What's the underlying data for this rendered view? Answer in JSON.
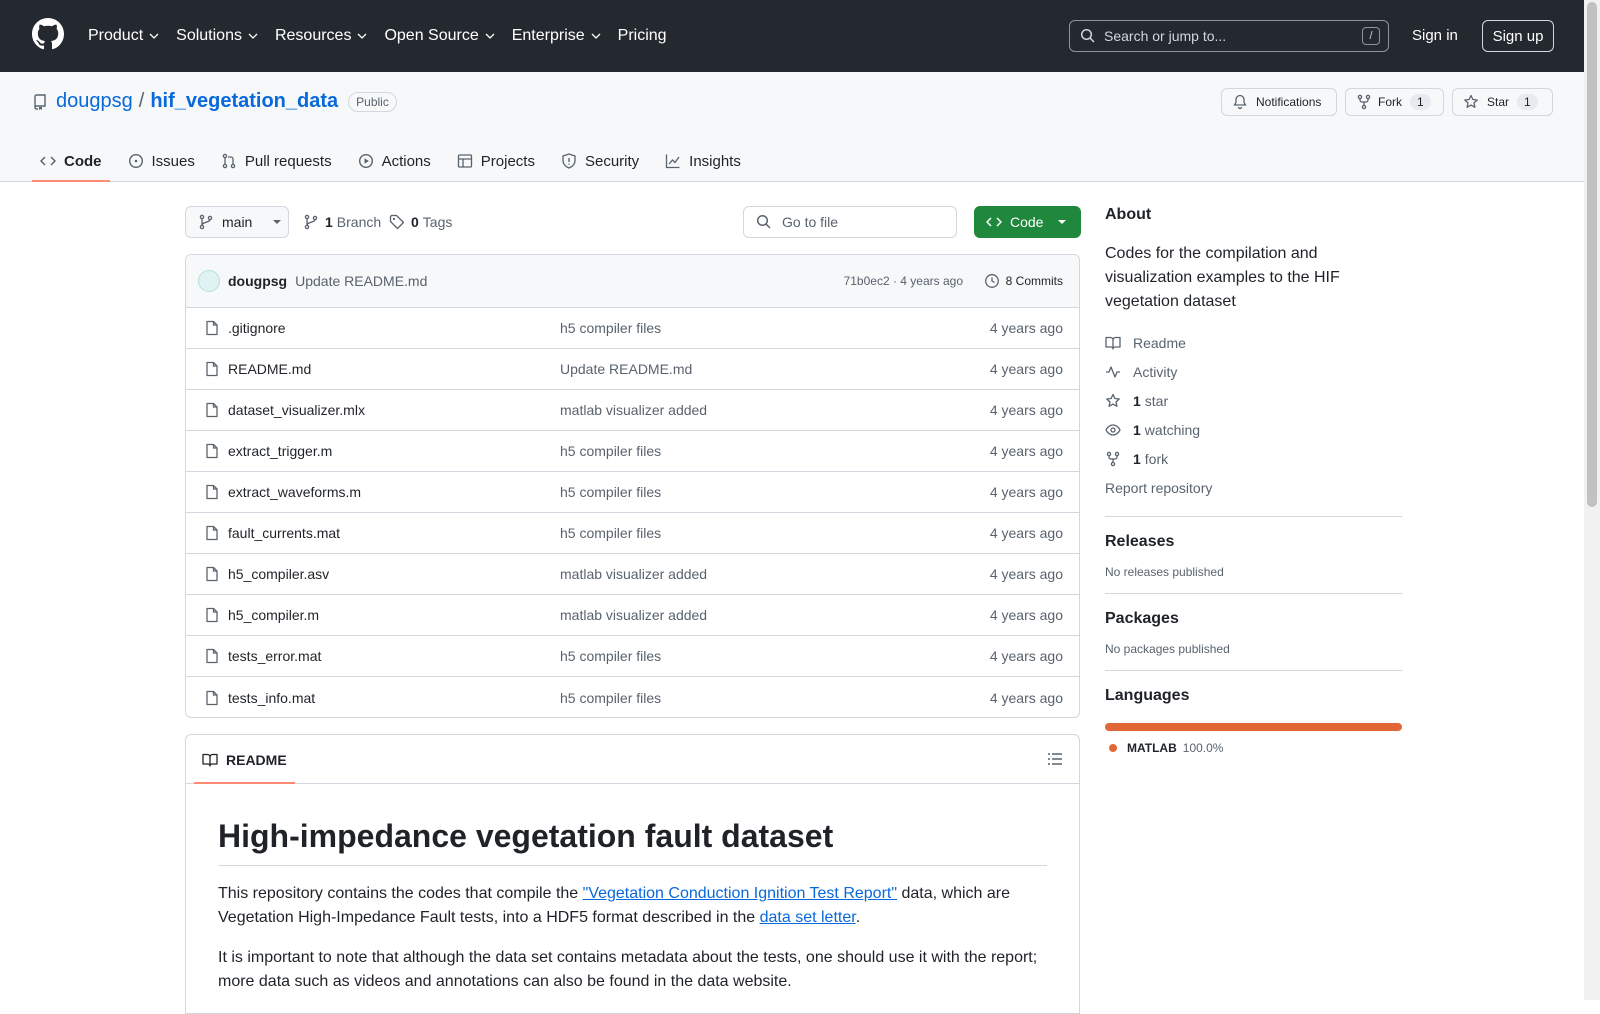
{
  "header": {
    "nav": [
      {
        "label": "Product",
        "dropdown": true
      },
      {
        "label": "Solutions",
        "dropdown": true
      },
      {
        "label": "Resources",
        "dropdown": true
      },
      {
        "label": "Open Source",
        "dropdown": true
      },
      {
        "label": "Enterprise",
        "dropdown": true
      },
      {
        "label": "Pricing",
        "dropdown": false
      }
    ],
    "search_placeholder": "Search or jump to...",
    "search_shortcut": "/",
    "sign_in": "Sign in",
    "sign_up": "Sign up"
  },
  "repo": {
    "owner": "dougpsg",
    "separator": "/",
    "name": "hif_vegetation_data",
    "visibility": "Public",
    "notifications_label": "Notifications",
    "fork_label": "Fork",
    "fork_count": "1",
    "star_label": "Star",
    "star_count": "1",
    "tabs": [
      {
        "label": "Code",
        "icon": "code-icon",
        "active": true
      },
      {
        "label": "Issues",
        "icon": "issue-icon",
        "active": false
      },
      {
        "label": "Pull requests",
        "icon": "pull-request-icon",
        "active": false
      },
      {
        "label": "Actions",
        "icon": "play-icon",
        "active": false
      },
      {
        "label": "Projects",
        "icon": "table-icon",
        "active": false
      },
      {
        "label": "Security",
        "icon": "shield-icon",
        "active": false
      },
      {
        "label": "Insights",
        "icon": "graph-icon",
        "active": false
      }
    ]
  },
  "toolbar": {
    "branch": "main",
    "branch_count": "1",
    "branch_label": "Branch",
    "tag_count": "0",
    "tag_label": "Tags",
    "go_to_file": "Go to file",
    "code_button": "Code"
  },
  "latest_commit": {
    "author": "dougpsg",
    "message": "Update README.md",
    "sha_time": "71b0ec2 · 4 years ago",
    "commits": "8 Commits"
  },
  "files": [
    {
      "name": ".gitignore",
      "message": "h5 compiler files",
      "age": "4 years ago"
    },
    {
      "name": "README.md",
      "message": "Update README.md",
      "age": "4 years ago"
    },
    {
      "name": "dataset_visualizer.mlx",
      "message": "matlab visualizer added",
      "age": "4 years ago"
    },
    {
      "name": "extract_trigger.m",
      "message": "h5 compiler files",
      "age": "4 years ago"
    },
    {
      "name": "extract_waveforms.m",
      "message": "h5 compiler files",
      "age": "4 years ago"
    },
    {
      "name": "fault_currents.mat",
      "message": "h5 compiler files",
      "age": "4 years ago"
    },
    {
      "name": "h5_compiler.asv",
      "message": "matlab visualizer added",
      "age": "4 years ago"
    },
    {
      "name": "h5_compiler.m",
      "message": "matlab visualizer added",
      "age": "4 years ago"
    },
    {
      "name": "tests_error.mat",
      "message": "h5 compiler files",
      "age": "4 years ago"
    },
    {
      "name": "tests_info.mat",
      "message": "h5 compiler files",
      "age": "4 years ago"
    }
  ],
  "readme": {
    "tab_label": "README",
    "title": "High-impedance vegetation fault dataset",
    "p1_before": "This repository contains the codes that compile the ",
    "p1_link1": "\"Vegetation Conduction Ignition Test Report\"",
    "p1_middle": " data, which are Vegetation High-Impedance Fault tests, into a HDF5 format described in the ",
    "p1_link2": "data set letter",
    "p1_after": ".",
    "p2": "It is important to note that although the data set contains metadata about the tests, one should use it with the report; more data such as videos and annotations can also be found in the data website."
  },
  "about": {
    "heading": "About",
    "description": "Codes for the compilation and visualization examples to the HIF vegetation dataset",
    "readme": "Readme",
    "activity": "Activity",
    "stars_count": "1",
    "stars_label": "star",
    "watching_count": "1",
    "watching_label": "watching",
    "forks_count": "1",
    "forks_label": "fork",
    "report": "Report repository"
  },
  "releases": {
    "heading": "Releases",
    "text": "No releases published"
  },
  "packages": {
    "heading": "Packages",
    "text": "No packages published"
  },
  "languages": {
    "heading": "Languages",
    "items": [
      {
        "name": "MATLAB",
        "percent": "100.0%",
        "fraction": 1.0,
        "color": "#e16737"
      }
    ]
  },
  "colors": {
    "header_bg": "#24292f",
    "link": "#0969da",
    "primary_button": "#1f883d",
    "tab_underline": "#fd8c73"
  }
}
